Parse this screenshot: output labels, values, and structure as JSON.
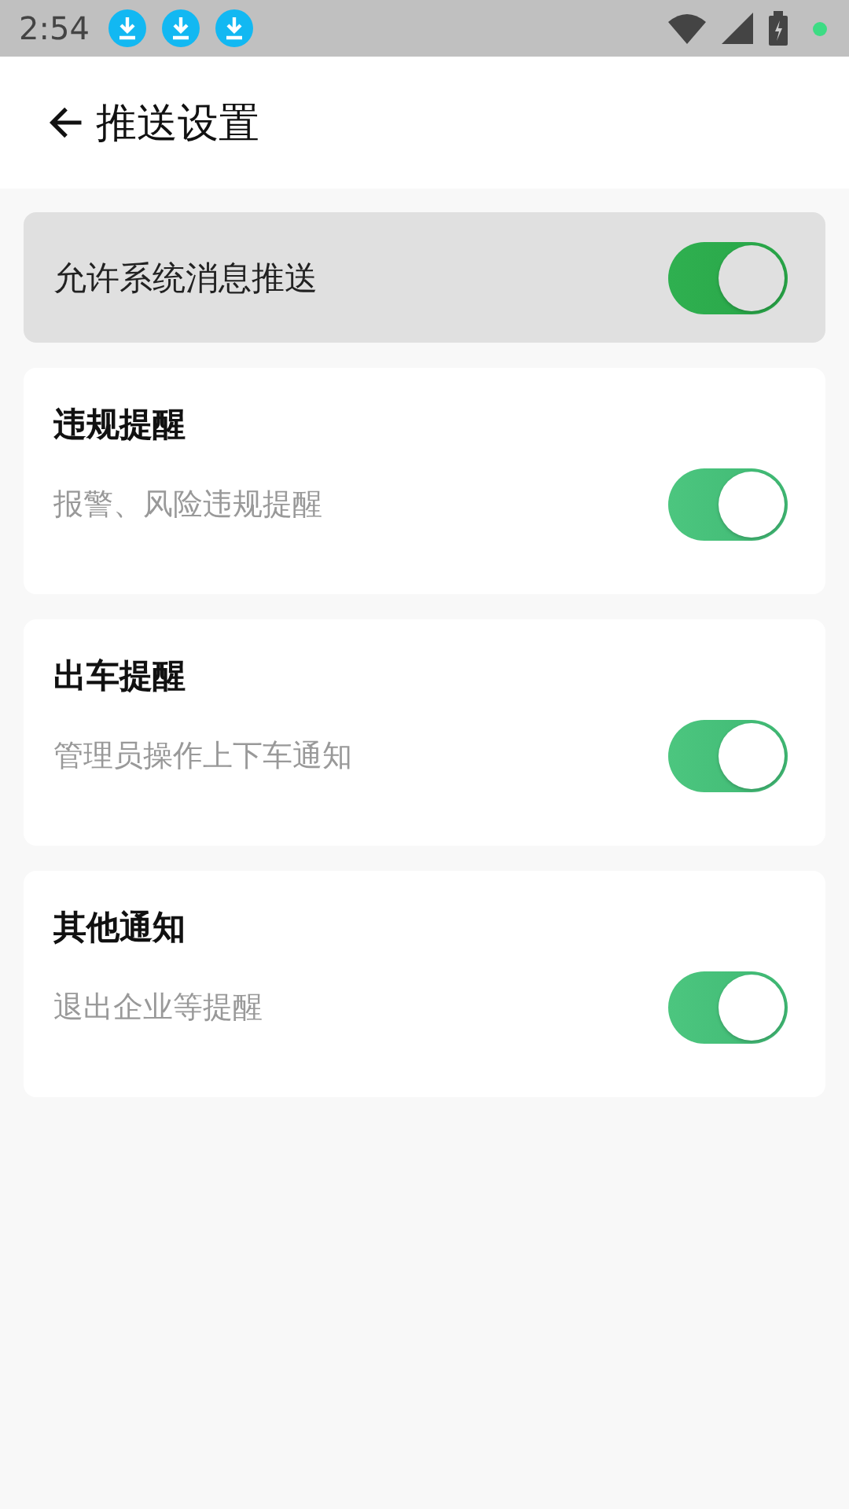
{
  "status_bar": {
    "time": "2:54",
    "notifications": [
      {
        "kind": "download"
      },
      {
        "kind": "download"
      },
      {
        "kind": "download"
      }
    ]
  },
  "header": {
    "title": "推送设置"
  },
  "master": {
    "label": "允许系统消息推送",
    "on": true
  },
  "sections": [
    {
      "title": "违规提醒",
      "description": "报警、风险违规提醒",
      "on": true
    },
    {
      "title": "出车提醒",
      "description": "管理员操作上下车通知",
      "on": true
    },
    {
      "title": "其他通知",
      "description": "退出企业等提醒",
      "on": true
    }
  ]
}
